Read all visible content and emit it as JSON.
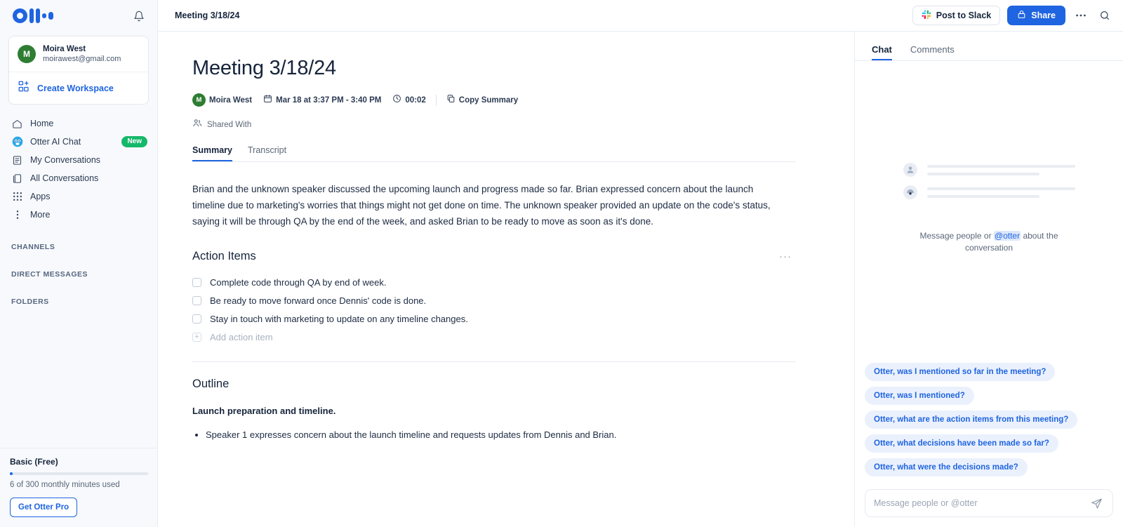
{
  "brand": {
    "name": "Otter",
    "primary": "#1f64e0",
    "green": "#14b86a",
    "avatar_green": "#2e7d32"
  },
  "sidebar": {
    "logo_name": "otter-logo",
    "bell_name": "notifications-bell",
    "profile": {
      "initial": "M",
      "name": "Moira West",
      "email": "moirawest@gmail.com"
    },
    "create_workspace": "Create Workspace",
    "nav": [
      {
        "label": "Home",
        "icon": "home-icon",
        "badge": ""
      },
      {
        "label": "Otter AI Chat",
        "icon": "otter-ai-icon",
        "badge": "New"
      },
      {
        "label": "My Conversations",
        "icon": "my-conversations-icon",
        "badge": ""
      },
      {
        "label": "All Conversations",
        "icon": "all-conversations-icon",
        "badge": ""
      },
      {
        "label": "Apps",
        "icon": "apps-grid-icon",
        "badge": ""
      },
      {
        "label": "More",
        "icon": "more-vertical-icon",
        "badge": ""
      }
    ],
    "sections": [
      "CHANNELS",
      "DIRECT MESSAGES",
      "FOLDERS"
    ],
    "footer": {
      "plan": "Basic (Free)",
      "usage": "6 of 300 monthly minutes used",
      "progress_percent": 2,
      "cta": "Get Otter Pro"
    }
  },
  "topbar": {
    "title": "Meeting 3/18/24",
    "post_to_slack": "Post to Slack",
    "share": "Share",
    "more_label": "···"
  },
  "doc": {
    "title": "Meeting 3/18/24",
    "owner_initial": "M",
    "owner": "Moira West",
    "date": "Mar 18 at 3:37 PM - 3:40 PM",
    "duration": "00:02",
    "copy_summary": "Copy Summary",
    "shared_with": "Shared With",
    "tabs": [
      {
        "label": "Summary",
        "active": true
      },
      {
        "label": "Transcript",
        "active": false
      }
    ],
    "summary": "Brian and the unknown speaker discussed the upcoming launch and progress made so far. Brian expressed concern about the launch timeline due to marketing's worries that things might not get done on time. The unknown speaker provided an update on the code's status, saying it will be through QA by the end of the week, and asked Brian to be ready to move as soon as it's done.",
    "action_items_heading": "Action Items",
    "action_items": [
      "Complete code through QA by end of week.",
      "Be ready to move forward once Dennis' code is done.",
      "Stay in touch with marketing to update on any timeline changes."
    ],
    "add_action_item": "Add action item",
    "outline_heading": "Outline",
    "outline_topic": "Launch preparation and timeline.",
    "outline_bullets": [
      "Speaker 1 expresses concern about the launch timeline and requests updates from Dennis and Brian."
    ]
  },
  "chat": {
    "tabs": [
      {
        "label": "Chat",
        "active": true
      },
      {
        "label": "Comments",
        "active": false
      }
    ],
    "empty_prefix": "Message people or ",
    "empty_mention": "@otter",
    "empty_suffix": " about the conversation",
    "suggestions": [
      "Otter, was I mentioned so far in the meeting?",
      "Otter, was I mentioned?",
      "Otter, what are the action items from this meeting?",
      "Otter, what decisions have been made so far?",
      "Otter, what were the decisions made?"
    ],
    "composer_placeholder": "Message people or @otter",
    "composer_value": ""
  }
}
